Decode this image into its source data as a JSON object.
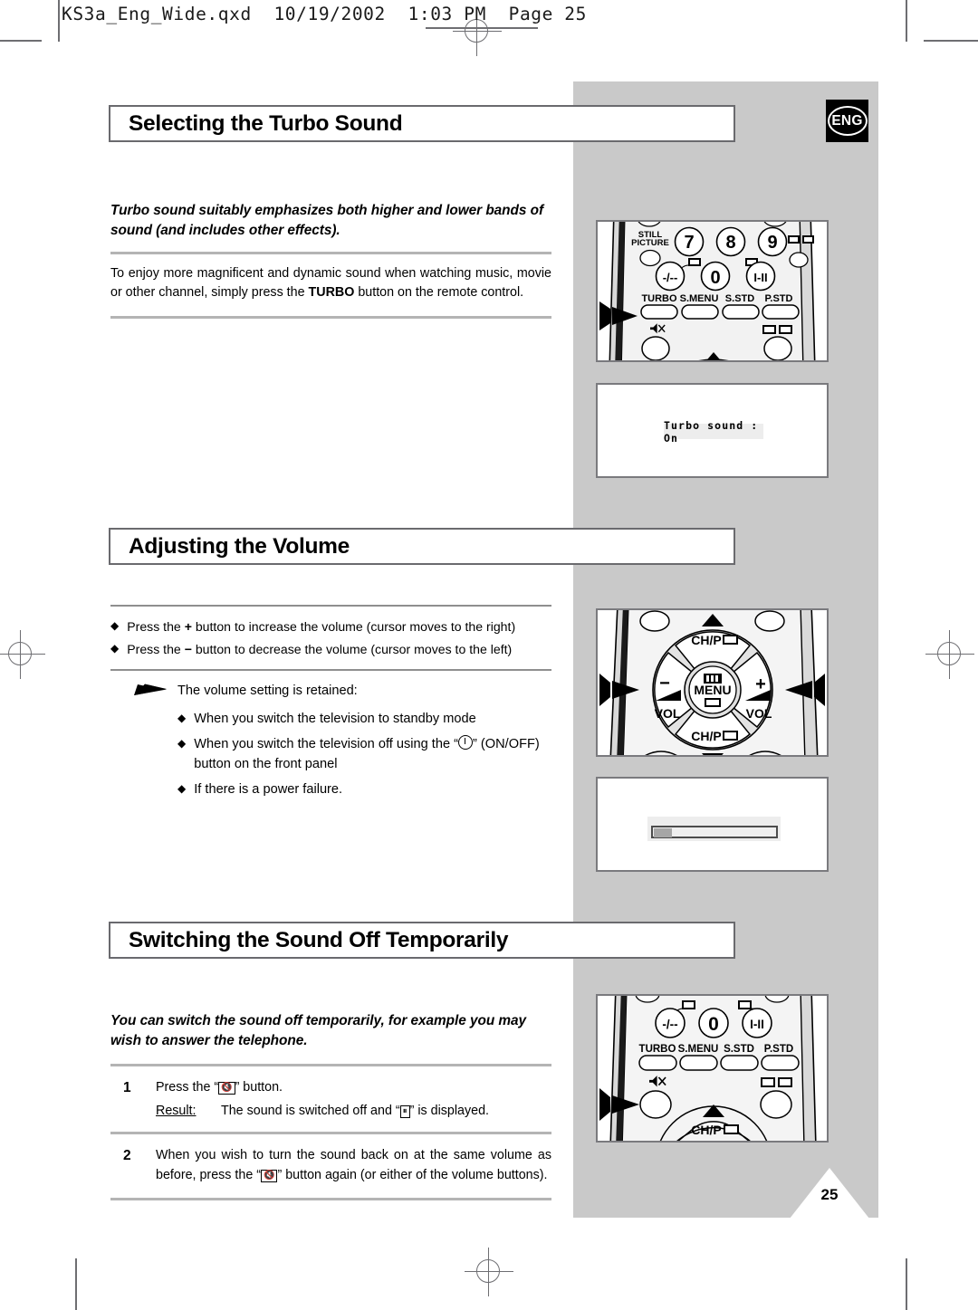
{
  "document_header": "KS3a_Eng_Wide.qxd  10/19/2002  1:03 PM  Page 25",
  "language_badge": "ENG",
  "page_number": "25",
  "sections": [
    {
      "heading": "Selecting the Turbo Sound",
      "lead": "Turbo sound suitably emphasizes both higher and lower bands of sound (and includes other effects).",
      "body_before_bold": "To enjoy more magnificent and dynamic sound when watching music, movie or other channel, simply press the ",
      "body_bold": "TURBO",
      "body_after_bold": " button on the remote control."
    },
    {
      "heading": "Adjusting the Volume",
      "bullets": [
        {
          "prefix": "Press the ",
          "symbol": "+",
          "suffix": " button to increase the volume (cursor moves to the right)"
        },
        {
          "prefix": "Press the ",
          "symbol": "−",
          "suffix": " button to decrease the volume (cursor moves to the left)"
        }
      ],
      "note_heading": "The volume setting is retained:",
      "note_bullets": [
        "When you switch the television to standby mode",
        "When you switch the television off using the “ⓘ” (ON/OFF) button on the front panel",
        "If there is a power failure."
      ],
      "note_bullet_2_part_a": "When you switch the television off using the “",
      "note_bullet_2_part_b": "” (ON/OFF) button on the front panel"
    },
    {
      "heading": "Switching the Sound Off Temporarily",
      "lead": "You can switch the sound off temporarily, for example you may wish to answer the telephone.",
      "steps": [
        {
          "num": "1",
          "text_a": "Press the “",
          "text_b": "” button.",
          "result_label": "Result:",
          "result_a": "The sound is switched off and “",
          "result_b": "” is displayed."
        },
        {
          "num": "2",
          "text_a": "When you wish to turn the sound back on at the same volume as before, press the “",
          "text_b": "” button again (or either of the volume buttons)."
        }
      ]
    }
  ],
  "illustrations": {
    "turbo_remote": {
      "still_picture_label_line1": "STILL",
      "still_picture_label_line2": "PICTURE",
      "number_keys": [
        "7",
        "8",
        "9"
      ],
      "second_row_keys": [
        "-/--",
        "0",
        "I-II"
      ],
      "function_row": [
        "TURBO",
        "S.MENU",
        "S.STD",
        "P.STD"
      ],
      "callout_target": "TURBO"
    },
    "turbo_osd": {
      "message": "Turbo sound : On"
    },
    "volume_remote": {
      "up_label": "CH/P",
      "down_label": "CH/P",
      "left_sign": "−",
      "right_sign": "+",
      "left_label": "VOL",
      "right_label": "VOL",
      "center_label": "MENU"
    },
    "volume_osd": {
      "fill_percent": 15
    },
    "mute_remote": {
      "second_row_keys": [
        "-/--",
        "0",
        "I-II"
      ],
      "function_row": [
        "TURBO",
        "S.MENU",
        "S.STD",
        "P.STD"
      ],
      "chp_label": "CH/P",
      "callout_target": "mute"
    }
  },
  "colors": {
    "panel_gray": "#c9c9c9",
    "heading_border": "#6a6a6e",
    "rule_light": "#b4b4b4",
    "rule_dark": "#8f8f8f",
    "osd_chip_bg": "#ededed",
    "vol_fill": "#a6a6a6",
    "remote_body": "#d9d9d9",
    "crop_mark": "#6e6e72"
  }
}
